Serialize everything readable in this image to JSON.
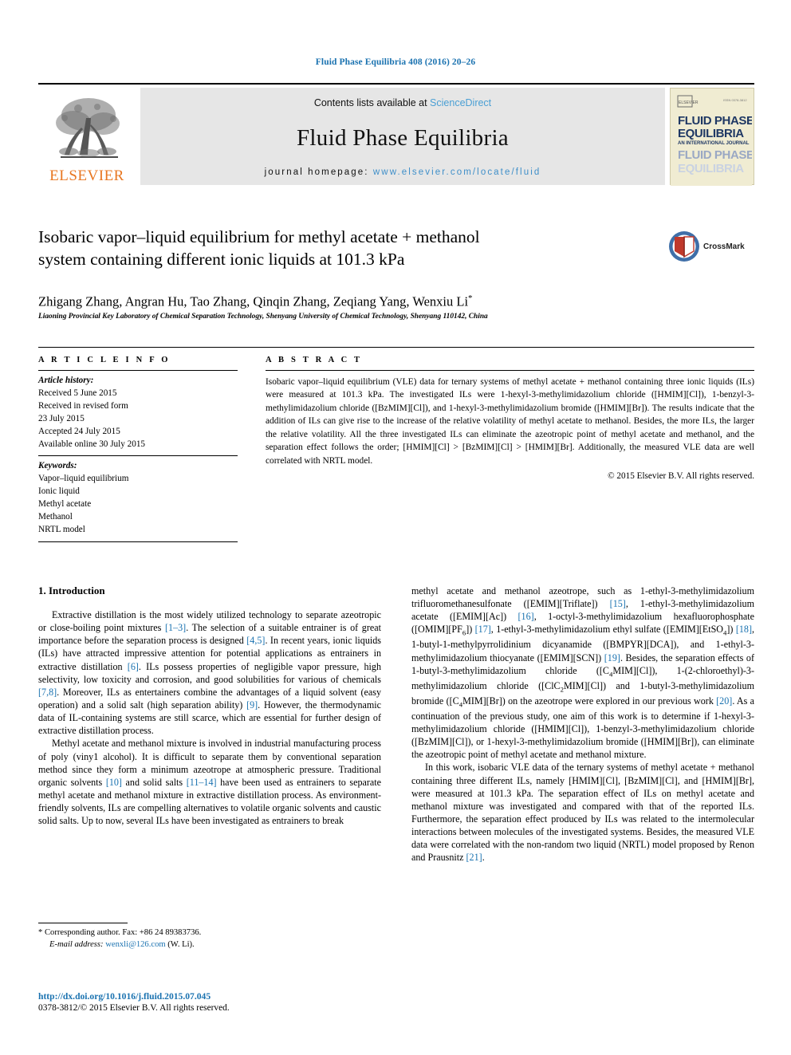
{
  "running_head": "Fluid Phase Equilibria 408 (2016) 20–26",
  "masthead": {
    "contents_prefix": "Contents lists available at ",
    "contents_link": "ScienceDirect",
    "journal_title": "Fluid Phase Equilibria",
    "homepage_prefix": "journal homepage:",
    "homepage_url": "www.elsevier.com/locate/fluid",
    "publisher_wordmark": "ELSEVIER",
    "publisher_color": "#E87722",
    "link_color": "#4a9fd4",
    "cover": {
      "line1": "FLUID PHASE",
      "line2": "EQUILIBRIA",
      "line3": "AN INTERNATIONAL JOURNAL",
      "line4": "FLUID PHASE",
      "line5": "EQUILIBRIA",
      "corner_text": "ELSEVIER"
    }
  },
  "article": {
    "title_line1": "Isobaric vapor–liquid equilibrium for methyl acetate + methanol",
    "title_line2": "system containing different ionic liquids at 101.3 kPa",
    "crossmark_label": "CrossMark",
    "authors": "Zhigang Zhang, Angran Hu, Tao Zhang, Qinqin Zhang, Zeqiang Yang, Wenxiu Li",
    "affiliation": "Liaoning Provincial Key Laboratory of Chemical Separation Technology, Shenyang University of Chemical Technology, Shenyang 110142, China"
  },
  "article_info": {
    "heading": "A R T I C L E   I N F O",
    "history_label": "Article history:",
    "history": [
      "Received 5 June 2015",
      "Received in revised form",
      "23 July 2015",
      "Accepted 24 July 2015",
      "Available online 30 July 2015"
    ],
    "keywords_label": "Keywords:",
    "keywords": [
      "Vapor–liquid equilibrium",
      "Ionic liquid",
      "Methyl acetate",
      "Methanol",
      "NRTL model"
    ]
  },
  "abstract": {
    "heading": "A B S T R A C T",
    "text": "Isobaric vapor–liquid equilibrium (VLE) data for ternary systems of methyl acetate + methanol containing three ionic liquids (ILs) were measured at 101.3 kPa. The investigated ILs were 1-hexyl-3-methylimidazolium chloride ([HMIM][Cl]), 1-benzyl-3-methylimidazolium chloride ([BzMIM][Cl]), and 1-hexyl-3-methylimidazolium bromide ([HMIM][Br]). The results indicate that the addition of ILs can give rise to the increase of the relative volatility of methyl acetate to methanol. Besides, the more ILs, the larger the relative volatility. All the three investigated ILs can eliminate the azeotropic point of methyl acetate and methanol, and the separation effect follows the order; [HMIM][Cl] > [BzMIM][Cl] > [HMIM][Br]. Additionally, the measured VLE data are well correlated with NRTL model.",
    "copyright": "© 2015 Elsevier B.V. All rights reserved."
  },
  "body": {
    "section_heading": "1.  Introduction",
    "left_paragraphs": [
      "Extractive distillation is the most widely utilized technology to separate azeotropic or close-boiling point mixtures [1–3]. The selection of a suitable entrainer is of great importance before the separation process is designed [4,5]. In recent years, ionic liquids (ILs) have attracted impressive attention for potential applications as entrainers in extractive distillation [6]. ILs possess properties of negligible vapor pressure, high selectivity, low toxicity and corrosion, and good solubilities for various of chemicals [7,8]. Moreover, ILs as entertainers combine the advantages of a liquid solvent (easy operation) and a solid salt (high separation ability) [9]. However, the thermodynamic data of IL-containing systems are still scarce, which are essential for further design of extractive distillation process.",
      "Methyl acetate and methanol mixture is involved in industrial manufacturing process of poly (viny1 alcohol). It is difficult to separate them by conventional separation method since they form a minimum azeotrope at atmospheric pressure. Traditional organic solvents [10] and solid salts [11–14] have been used as entrainers to separate methyl acetate and methanol mixture in extractive distillation process. As environment-friendly solvents, ILs are compelling alternatives to volatile organic solvents and caustic solid salts. Up to now, several ILs have been investigated as entrainers to break"
    ],
    "right_paragraphs": [
      "methyl acetate and methanol azeotrope, such as 1-ethyl-3-methylimidazolium trifluoromethanesulfonate ([EMIM][Triflate]) [15], 1-ethyl-3-methylimidazolium acetate ([EMIM][Ac]) [16], 1-octyl-3-methylimidazolium hexafluorophosphate ([OMIM][PF6]) [17], 1-ethyl-3-methylimidazolium ethyl sulfate ([EMIM][EtSO4]) [18], 1-butyl-1-methylpyrrolidinium dicyanamide ([BMPYR][DCA]), and 1-ethyl-3-methylimidazolium thiocyanate ([EMIM][SCN]) [19]. Besides, the separation effects of 1-butyl-3-methylimidazolium chloride ([C4MIM][Cl]), 1-(2-chloroethyl)-3-methylimidazolium chloride ([ClC2MIM][Cl]) and 1-butyl-3-methylimidazolium bromide ([C4MIM][Br]) on the azeotrope were explored in our previous work [20]. As a continuation of the previous study, one aim of this work is to determine if 1-hexyl-3-methylimidazolium chloride ([HMIM][Cl]), 1-benzyl-3-methylimidazolium chloride ([BzMIM][Cl]), or 1-hexyl-3-methylimidazolium bromide ([HMIM][Br]), can eliminate the azeotropic point of methyl acetate and methanol mixture.",
      "In this work, isobaric VLE data of the ternary systems of methyl acetate + methanol containing three different ILs, namely [HMIM][Cl], [BzMIM][Cl], and [HMIM][Br], were measured at 101.3 kPa. The separation effect of ILs on methyl acetate and methanol mixture was investigated and compared with that of the reported ILs. Furthermore, the separation effect produced by ILs was related to the intermolecular interactions between molecules of the investigated systems. Besides, the measured VLE data were correlated with the non-random two liquid (NRTL) model proposed by Renon and Prausnitz [21]."
    ]
  },
  "footer": {
    "corr_marker": "*",
    "corr_text": "Corresponding author. Fax: +86 24 89383736.",
    "email_label": "E-mail address:",
    "email": "wenxli@126.com",
    "email_suffix": "(W. Li).",
    "doi": "http://dx.doi.org/10.1016/j.fluid.2015.07.045",
    "issn_line": "0378-3812/© 2015 Elsevier B.V. All rights reserved.",
    "link_color": "#1a72b0"
  }
}
